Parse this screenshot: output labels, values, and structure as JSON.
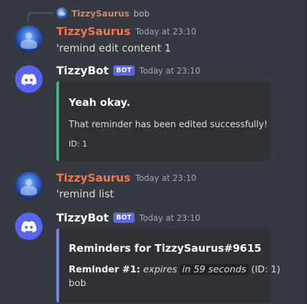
{
  "reply": {
    "author": "TizzySaurus",
    "text": "bob"
  },
  "messages": [
    {
      "author": "TizzySaurus",
      "timestamp": "Today at 23:10",
      "content": "'remind edit content 1"
    },
    {
      "author": "TizzyBot",
      "bot_tag": "BOT",
      "timestamp": "Today at 23:10",
      "embed": {
        "title": "Yeah okay.",
        "description": "That reminder has been edited successfully!",
        "footer": "ID: 1",
        "color": "#43b581"
      }
    },
    {
      "author": "TizzySaurus",
      "timestamp": "Today at 23:10",
      "content": "'remind list"
    },
    {
      "author": "TizzyBot",
      "bot_tag": "BOT",
      "timestamp": "Today at 23:10",
      "embed": {
        "title": "Reminders for TizzySaurus#9615",
        "reminder_label": "Reminder #1:",
        "expires_word": "expires",
        "expires_value": "in 59 seconds",
        "id_text": "(ID: 1)",
        "body": "bob",
        "color": "#7289da"
      }
    }
  ],
  "icons": {
    "user_avatar": "avatar-user-icon",
    "bot_avatar": "discord-logo-icon"
  },
  "colors": {
    "background": "#36393f",
    "user_name": "#f0784e",
    "bot_tag": "#5865f2",
    "embed_bg": "#2f3136"
  }
}
